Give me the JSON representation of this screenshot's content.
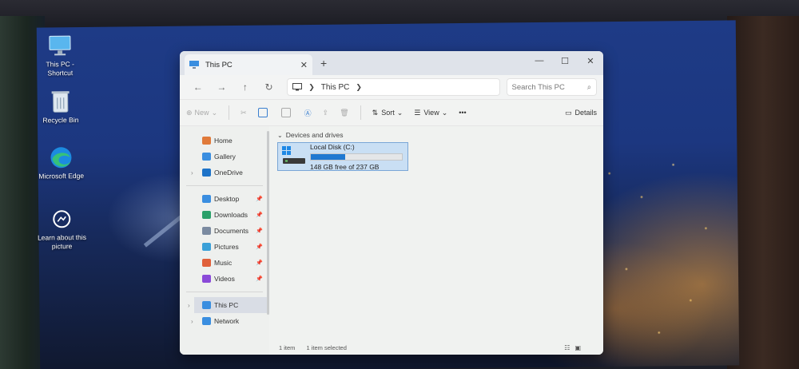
{
  "desktop": {
    "icons": [
      {
        "label": "This PC - Shortcut",
        "icon": "monitor-icon"
      },
      {
        "label": "Recycle Bin",
        "icon": "recycle-bin-icon"
      },
      {
        "label": "Microsoft Edge",
        "icon": "edge-icon"
      },
      {
        "label": "Learn about this picture",
        "icon": "camera-icon"
      }
    ]
  },
  "window": {
    "tab_title": "This PC",
    "tab_close": "✕",
    "new_tab": "+",
    "controls": {
      "minimize": "—",
      "maximize": "☐",
      "close": "✕"
    },
    "nav": {
      "back": "←",
      "forward": "→",
      "up": "↑",
      "refresh": "↻"
    },
    "breadcrumb": "This PC",
    "search_placeholder": "Search This PC",
    "toolbar": {
      "new": "New",
      "sort": "Sort",
      "view": "View",
      "more": "•••",
      "details": "Details"
    },
    "sidebar": {
      "top": [
        {
          "label": "Home",
          "icon": "home-icon",
          "color": "#e07a3a"
        },
        {
          "label": "Gallery",
          "icon": "gallery-icon",
          "color": "#3a8ee0"
        },
        {
          "label": "OneDrive",
          "icon": "onedrive-icon",
          "color": "#1e73c8"
        }
      ],
      "pinned": [
        {
          "label": "Desktop",
          "icon": "desktop-folder-icon",
          "color": "#3a8ee0"
        },
        {
          "label": "Downloads",
          "icon": "downloads-icon",
          "color": "#2aa06a"
        },
        {
          "label": "Documents",
          "icon": "documents-icon",
          "color": "#7a8aa0"
        },
        {
          "label": "Pictures",
          "icon": "pictures-icon",
          "color": "#3aa0d8"
        },
        {
          "label": "Music",
          "icon": "music-icon",
          "color": "#e0603a"
        },
        {
          "label": "Videos",
          "icon": "videos-icon",
          "color": "#8a4ad8"
        }
      ],
      "bottom": [
        {
          "label": "This PC",
          "icon": "this-pc-icon",
          "color": "#3a8ee0",
          "selected": true
        },
        {
          "label": "Network",
          "icon": "network-icon",
          "color": "#3a8ee0"
        }
      ]
    },
    "content": {
      "group_header": "Devices and drives",
      "drive": {
        "name": "Local Disk (C:)",
        "used_fraction": 0.375,
        "free_text": "148 GB free of 237 GB"
      }
    },
    "status": {
      "count": "1 item",
      "selected": "1 item selected"
    }
  }
}
